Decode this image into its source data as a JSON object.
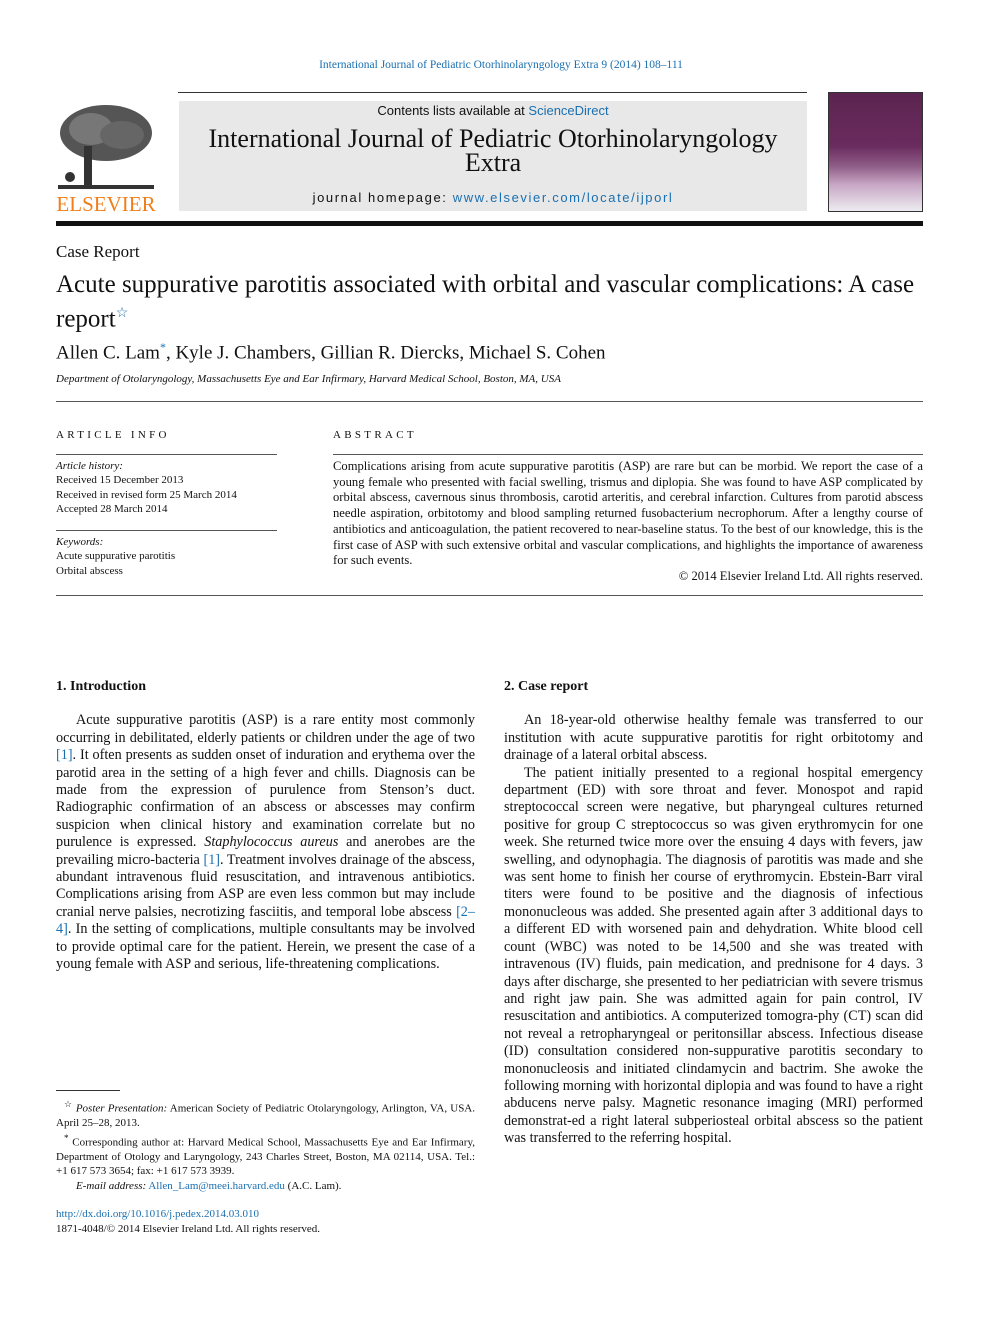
{
  "header": {
    "citation": "International Journal of Pediatric Otorhinolaryngology Extra 9 (2014) 108–111",
    "contents_prefix": "Contents lists available at ",
    "contents_link": "ScienceDirect",
    "journal_title": "International Journal of Pediatric Otorhinolaryngology Extra",
    "homepage_prefix": "journal homepage: ",
    "homepage_link": "www.elsevier.com/locate/ijporl",
    "publisher_logo": "ELSEVIER"
  },
  "article": {
    "type": "Case Report",
    "title": "Acute suppurative parotitis associated with orbital and vascular complications: A case report",
    "title_mark": "☆",
    "authors": [
      {
        "name": "Allen C. Lam",
        "mark": "*"
      },
      {
        "name": ", Kyle J. Chambers, Gillian R. Diercks, Michael S. Cohen",
        "mark": ""
      }
    ],
    "affiliation": "Department of Otolaryngology, Massachusetts Eye and Ear Infirmary, Harvard Medical School, Boston, MA, USA"
  },
  "article_info": {
    "heading": "ARTICLE INFO",
    "history_label": "Article history:",
    "history": [
      "Received 15 December 2013",
      "Received in revised form 25 March 2014",
      "Accepted 28 March 2014"
    ],
    "keywords_label": "Keywords:",
    "keywords": [
      "Acute suppurative parotitis",
      "Orbital abscess"
    ]
  },
  "abstract": {
    "heading": "ABSTRACT",
    "text": "Complications arising from acute suppurative parotitis (ASP) are rare but can be morbid. We report the case of a young female who presented with facial swelling, trismus and diplopia. She was found to have ASP complicated by orbital abscess, cavernous sinus thrombosis, carotid arteritis, and cerebral infarction. Cultures from parotid abscess needle aspiration, orbitotomy and blood sampling returned fusobacterium necrophorum. After a lengthy course of antibiotics and anticoagulation, the patient recovered to near-baseline status. To the best of our knowledge, this is the first case of ASP with such extensive orbital and vascular complications, and highlights the importance of awareness for such events.",
    "copyright": "© 2014 Elsevier Ireland Ltd. All rights reserved."
  },
  "sections": [
    {
      "heading": "1.  Introduction",
      "paragraphs": [
        [
          {
            "t": "Acute suppurative parotitis (ASP) is a rare entity most commonly occurring in debilitated, elderly patients or children under the age of two "
          },
          {
            "t": "[1]",
            "link": true
          },
          {
            "t": ". It often presents as sudden onset of induration and erythema over the parotid area in the setting of a high fever and chills. Diagnosis can be made from the expression of purulence from Stenson’s duct. Radiographic confirmation of an abscess or abscesses may confirm suspicion when clinical history and examination correlate but no purulence is expressed. "
          },
          {
            "t": "Staphylococcus aureus",
            "italic": true
          },
          {
            "t": " and anerobes are the prevailing micro-bacteria "
          },
          {
            "t": "[1]",
            "link": true
          },
          {
            "t": ". Treatment involves drainage of the abscess, abundant intravenous fluid resuscitation, and intravenous antibiotics. Complications arising from ASP are even less common but may include cranial nerve palsies, necrotizing fasciitis, and temporal lobe abscess "
          },
          {
            "t": "[2–4]",
            "link": true
          },
          {
            "t": ". In the setting of complications, multiple consultants may be involved to provide optimal care for the patient. Herein, we present the case of a young female with ASP and serious, life-threatening complications."
          }
        ]
      ]
    },
    {
      "heading": "2.  Case report",
      "paragraphs": [
        [
          {
            "t": "An 18-year-old otherwise healthy female was transferred to our institution with acute suppurative parotitis for right orbitotomy and drainage of a lateral orbital abscess."
          }
        ],
        [
          {
            "t": "The patient initially presented to a regional hospital emergency department (ED) with sore throat and fever. Monospot and rapid streptococcal screen were negative, but pharyngeal cultures returned positive for group C streptococcus so was given erythromycin for one week. She returned twice more over the ensuing 4 days with fevers, jaw swelling, and odynophagia. The diagnosis of parotitis was made and she was sent home to finish her course of erythromycin. Ebstein-Barr viral titers were found to be positive and the diagnosis of infectious mononucleous was added. She presented again after 3 additional days to a different ED with worsened pain and dehydration. White blood cell count (WBC) was noted to be 14,500 and she was treated with intravenous (IV) fluids, pain medication, and prednisone for 4 days. 3 days after discharge, she presented to her pediatrician with severe trismus and right jaw pain. She was admitted again for pain control, IV resuscitation and antibiotics. A computerized tomogra-phy (CT) scan did not reveal a retropharyngeal or peritonsillar abscess. Infectious disease (ID) consultation considered non-suppurative parotitis secondary to mononucleosis and initiated clindamycin and bactrim. She awoke the following morning with horizontal diplopia and was found to have a right abducens nerve palsy. Magnetic resonance imaging (MRI) performed demonstrat-ed a right lateral subperiosteal orbital abscess so the patient was transferred to the referring hospital."
          }
        ]
      ]
    }
  ],
  "footnotes": {
    "star_mark": "☆",
    "star_label": "Poster Presentation:",
    "star_text": " American Society of Pediatric Otolaryngology, Arlington, VA, USA. April 25–28, 2013.",
    "corr_mark": "*",
    "corr_text": " Corresponding author at: Harvard Medical School, Massachusetts Eye and Ear Infirmary, Department of Otology and Laryngology, 243 Charles Street, Boston, MA 02114, USA. Tel.: +1 617 573 3654; fax: +1 617 573 3939.",
    "email_label": "E-mail address:",
    "email": "Allen_Lam@meei.harvard.edu",
    "email_suffix": " (A.C. Lam).",
    "doi": "http://dx.doi.org/10.1016/j.pedex.2014.03.010",
    "issn": "1871-4048/© 2014 Elsevier Ireland Ltd. All rights reserved."
  },
  "colors": {
    "link": "#1a6fb0",
    "elsevier_orange": "#f07f1b",
    "banner_bg": "#e8e8e8"
  }
}
